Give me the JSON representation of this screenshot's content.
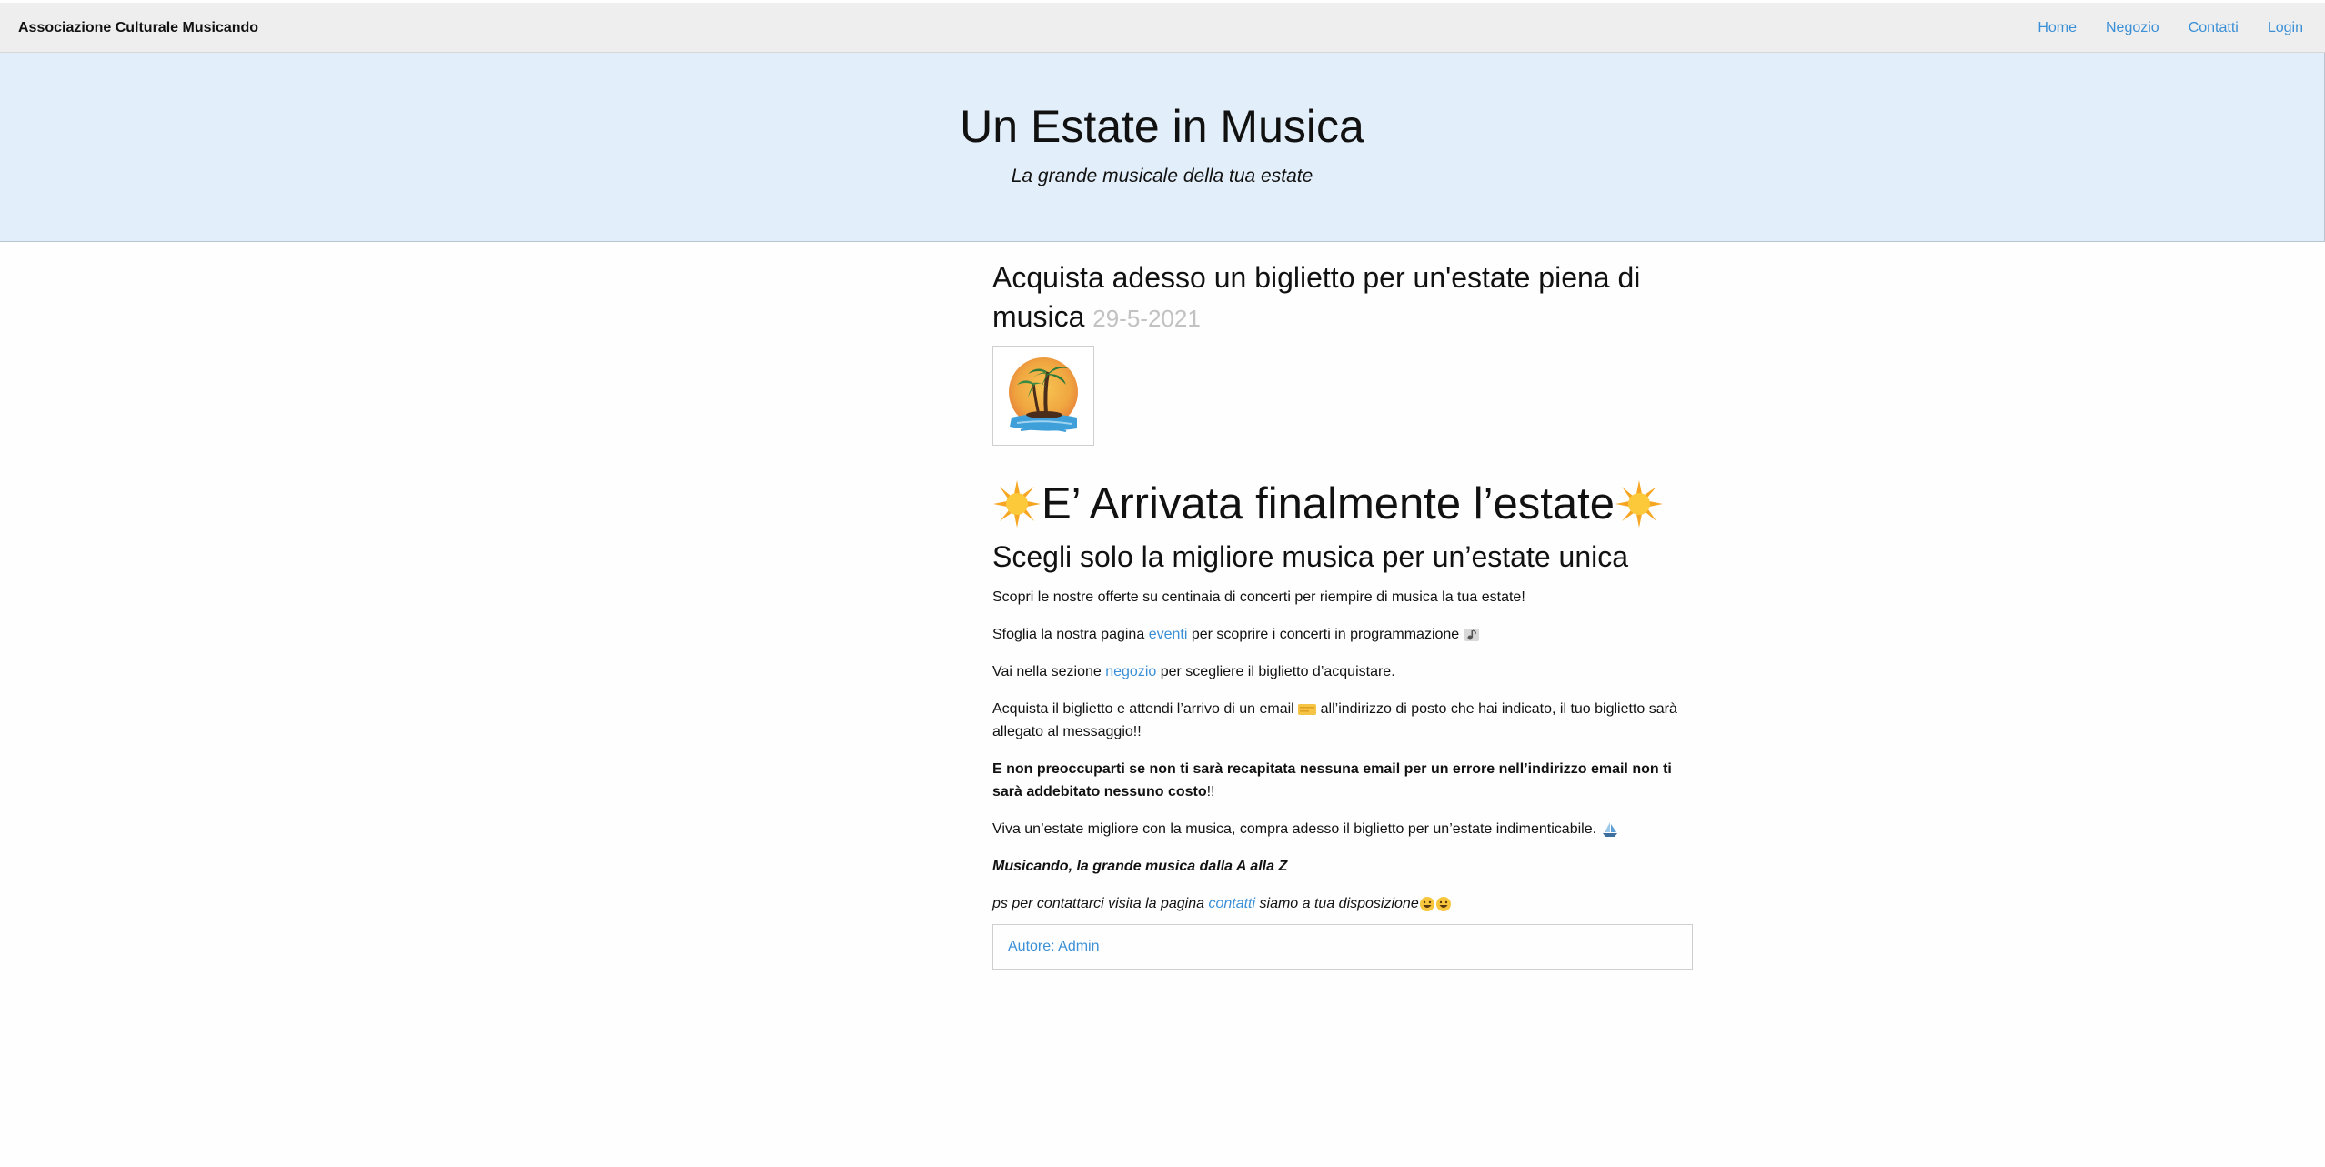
{
  "nav": {
    "brand": "Associazione Culturale Musicando",
    "links": [
      "Home",
      "Negozio",
      "Contatti",
      "Login"
    ]
  },
  "hero": {
    "title": "Un Estate in Musica",
    "subtitle": "La grande musicale della tua estate"
  },
  "post": {
    "title": "Acquista adesso un biglietto per un'estate piena di musica",
    "date": "29-5-2021",
    "image_icon": "palm-island-sunset-icon",
    "headline": "E’ Arrivata finalmente l’estate",
    "headline_icon": "sun-icon",
    "subheadline": "Scegli solo la migliore musica per un’estate unica",
    "p1": "Scopri le nostre offerte su centinaia di concerti per riempire di musica la tua estate!",
    "p2_before": "Sfoglia la nostra pagina",
    "p2_link": "eventi",
    "p2_after": "per scoprire i concerti in programmazione",
    "p2_icon": "music-note-icon",
    "p3_before": "Vai nella sezione",
    "p3_link": "negozio",
    "p3_after": "per scegliere il biglietto d’acquistare.",
    "p4_before": "Acquista il biglietto e attendi l’arrivo di un email",
    "p4_icon": "ticket-icon",
    "p4_after": "all’indirizzo di posto che hai indicato, il tuo biglietto sarà allegato al messaggio!!",
    "p5_bold": "E non preoccuparti se non ti sarà recapitata nessuna email per un errore nell’indirizzo email non ti sarà addebitato nessuno costo",
    "p5_end": "!!",
    "p6": "Viva un’estate migliore con la musica, compra adesso il biglietto per un’estate indimenticabile.",
    "p6_icon": "sailboat-icon",
    "p7": "Musicando, la grande musica dalla A alla Z",
    "p8_before": "ps per contattarci visita la pagina",
    "p8_link": "contatti",
    "p8_after": "siamo a tua disposizione",
    "p8_icon": "grinning-face-icon",
    "author": "Autore: Admin"
  },
  "colors": {
    "link": "#3a8fd6",
    "hero_bg": "#e2eef9",
    "nav_bg": "#eeeeee",
    "date": "#c2c2c2"
  }
}
